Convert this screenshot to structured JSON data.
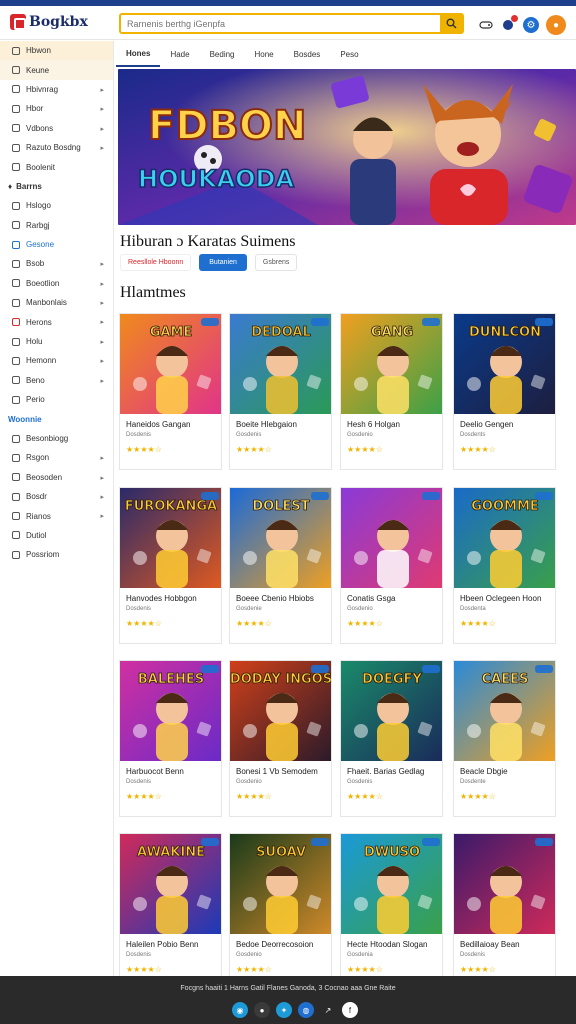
{
  "header": {
    "logo_text": "Bogkbx",
    "search_placeholder": "Rarnenis berthg iGenpfa"
  },
  "sidebar": {
    "items_a": [
      {
        "label": "Hbwon",
        "arrow": false,
        "state": "active"
      },
      {
        "label": "Keune",
        "arrow": false,
        "state": "hover"
      },
      {
        "label": "Hbivnrag",
        "arrow": true,
        "state": ""
      },
      {
        "label": "Hbor",
        "arrow": true,
        "state": ""
      },
      {
        "label": "Vdbons",
        "arrow": true,
        "state": ""
      },
      {
        "label": "Razuto Bosdng",
        "arrow": true,
        "state": ""
      },
      {
        "label": "Boolenit",
        "arrow": false,
        "state": ""
      }
    ],
    "head_b": "Barrns",
    "items_b": [
      {
        "label": "Hslogo",
        "arrow": false,
        "state": ""
      },
      {
        "label": "Rarbgj",
        "arrow": false,
        "state": ""
      },
      {
        "label": "Gesone",
        "arrow": false,
        "state": "sel"
      },
      {
        "label": "Bsob",
        "arrow": true,
        "state": ""
      },
      {
        "label": "Boeotlion",
        "arrow": true,
        "state": ""
      },
      {
        "label": "Manbonlais",
        "arrow": true,
        "state": ""
      },
      {
        "label": "Herons",
        "arrow": true,
        "state": "red"
      },
      {
        "label": "Holu",
        "arrow": true,
        "state": ""
      },
      {
        "label": "Hemonn",
        "arrow": true,
        "state": ""
      },
      {
        "label": "Beno",
        "arrow": true,
        "state": ""
      },
      {
        "label": "Perio",
        "arrow": false,
        "state": ""
      }
    ],
    "head_c": "Woonnie",
    "items_c": [
      {
        "label": "Besonbiogg",
        "arrow": false,
        "state": ""
      },
      {
        "label": "Rsgon",
        "arrow": true,
        "state": ""
      },
      {
        "label": "Beosoden",
        "arrow": true,
        "state": ""
      },
      {
        "label": "Bosdr",
        "arrow": true,
        "state": ""
      },
      {
        "label": "Rianos",
        "arrow": true,
        "state": ""
      },
      {
        "label": "Dutiol",
        "arrow": false,
        "state": ""
      },
      {
        "label": "Possriom",
        "arrow": false,
        "state": ""
      }
    ]
  },
  "tabs": [
    "Hones",
    "Hade",
    "Beding",
    "Hone",
    "Bosdes",
    "Peso"
  ],
  "hero": {
    "line1": "FDBON",
    "line2": "HOUKAODA"
  },
  "section_title": "Hiburan ɔ Karatas Suimens",
  "chips": [
    "Reesllole Hboonn",
    "Butanien",
    "Gsbrens"
  ],
  "games_title": "Hlamtmes",
  "cards": [
    {
      "title": "Haneidos Gangan",
      "sub": "Dosdenis",
      "stars": "★★★★☆",
      "art": "GAME",
      "c1": "#f08a1c",
      "c2": "#e0338a",
      "c3": "#ffd24a"
    },
    {
      "title": "Boeite Hlebgaion",
      "sub": "Gosdenis",
      "stars": "★★★★☆",
      "art": "DEDOAL",
      "c1": "#3a7ad0",
      "c2": "#2a9a55",
      "c3": "#f0c030"
    },
    {
      "title": "Hesh 6 Holgan",
      "sub": "Gosdenio",
      "stars": "★★★★☆",
      "art": "GANG",
      "c1": "#f0a020",
      "c2": "#3aa048",
      "c3": "#ffe066"
    },
    {
      "title": "Deelio Gengen",
      "sub": "Dosdents",
      "stars": "★★★★☆",
      "art": "DUNLCON",
      "c1": "#0a3a8a",
      "c2": "#1e1e3e",
      "c3": "#ffcc33"
    },
    {
      "title": "Hanvodes Hobbgon",
      "sub": "Dosdenis",
      "stars": "★★★★☆",
      "art": "FUROKANGA",
      "c1": "#2a2a6a",
      "c2": "#e05a20",
      "c3": "#ffcc33"
    },
    {
      "title": "Boeee Cbenio Hbiobs",
      "sub": "Gosdenie",
      "stars": "★★★★☆",
      "art": "DOLEST",
      "c1": "#1a6ad8",
      "c2": "#f0a020",
      "c3": "#ffe066"
    },
    {
      "title": "Conatis Gsga",
      "sub": "Gosdenio",
      "stars": "★★★★☆",
      "art": "",
      "c1": "#8a3ad8",
      "c2": "#e03a70",
      "c3": "#ffffff"
    },
    {
      "title": "Hbeen Oclegeen Hoon",
      "sub": "Dosdenta",
      "stars": "★★★★☆",
      "art": "GOOMME",
      "c1": "#1a6ac8",
      "c2": "#3aa048",
      "c3": "#ffcc33"
    },
    {
      "title": "Harbuocot Benn",
      "sub": "Dosdenis",
      "stars": "★★★★☆",
      "art": "BALEHES",
      "c1": "#d030a0",
      "c2": "#6a2ac8",
      "c3": "#ffd24a"
    },
    {
      "title": "Bonesi 1 Vb Semodem",
      "sub": "Gosdenio",
      "stars": "★★★★☆",
      "art": "DODAY INGOS",
      "c1": "#d0401a",
      "c2": "#2a1a2a",
      "c3": "#ffcc33"
    },
    {
      "title": "Fhaeit. Barias Gedlag",
      "sub": "Gosdenis",
      "stars": "★★★★☆",
      "art": "DOEGFY",
      "c1": "#1a8a6a",
      "c2": "#1a2a5a",
      "c3": "#ffcc33"
    },
    {
      "title": "Beacle Dbgie",
      "sub": "Dosdente",
      "stars": "★★★★☆",
      "art": "CAEES",
      "c1": "#2a8ad8",
      "c2": "#f0a020",
      "c3": "#ffe066"
    },
    {
      "title": "Haleilen Pobio Benn",
      "sub": "Dosdenis",
      "stars": "★★★★☆",
      "art": "AWAKINE",
      "c1": "#d02a5a",
      "c2": "#1a3ab8",
      "c3": "#ffcc33"
    },
    {
      "title": "Bedoe Deorrecosoion",
      "sub": "Gosdenio",
      "stars": "★★★★☆",
      "art": "SUOAV",
      "c1": "#1a3a1a",
      "c2": "#d08a2a",
      "c3": "#ffcc33"
    },
    {
      "title": "Hecte Htoodan Slogan",
      "sub": "Gosdenia",
      "stars": "★★★★☆",
      "art": "DWUSO",
      "c1": "#1a9ad8",
      "c2": "#3aa048",
      "c3": "#ffcc33"
    },
    {
      "title": "Bedillaioay Bean",
      "sub": "Dosdenis",
      "stars": "★★★★☆",
      "art": "",
      "c1": "#3a1a6a",
      "c2": "#d02a5a",
      "c3": "#ffcc33"
    }
  ],
  "footer": {
    "text": "Focgns haaiti 1 Harns Gatil Flanes Ganoda, 3 Cocnao aaa Gne Raite",
    "socials": [
      {
        "icon": "globe-icon",
        "glyph": "◉",
        "color": "#1e9ad8"
      },
      {
        "icon": "chat-icon",
        "glyph": "●",
        "color": "#3a3a3a"
      },
      {
        "icon": "twitter-icon",
        "glyph": "✦",
        "color": "#1e9ad8"
      },
      {
        "icon": "message-icon",
        "glyph": "◍",
        "color": "#1e6fd0"
      },
      {
        "icon": "share-icon",
        "glyph": "↗",
        "color": "#2a2a2a"
      },
      {
        "icon": "fb-icon",
        "glyph": "f",
        "color": "#ffffff"
      }
    ]
  }
}
